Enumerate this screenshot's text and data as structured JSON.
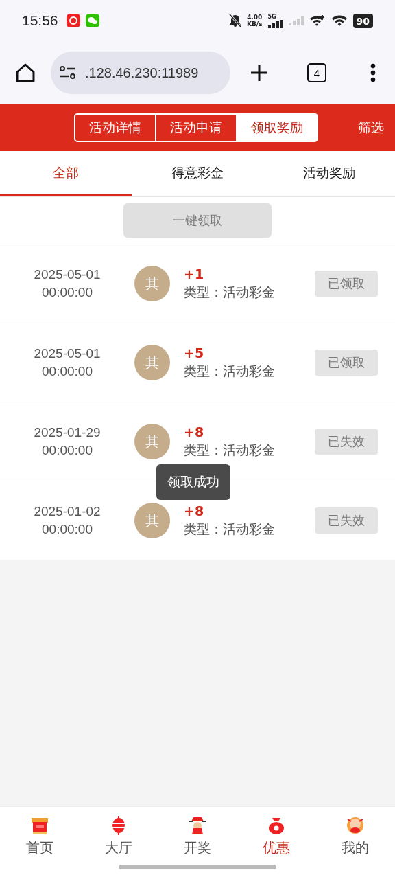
{
  "status_bar": {
    "time": "15:56",
    "speed_value": "4.00",
    "speed_unit": "KB/s",
    "network": "5G",
    "battery": "90"
  },
  "browser": {
    "url": ".128.46.230:11989",
    "tab_count": "4"
  },
  "header": {
    "segments": [
      {
        "label": "活动详情",
        "selected": false
      },
      {
        "label": "活动申请",
        "selected": false
      },
      {
        "label": "领取奖励",
        "selected": true
      }
    ],
    "filter": "筛选"
  },
  "tabs": [
    {
      "label": "全部",
      "selected": true
    },
    {
      "label": "得意彩金",
      "selected": false
    },
    {
      "label": "活动奖励",
      "selected": false
    }
  ],
  "claim_all": {
    "label": "一键领取",
    "disabled": true
  },
  "rows": [
    {
      "date": "2025-05-01",
      "time": "00:00:00",
      "avatar": "其",
      "amount": "+1",
      "type": "类型：活动彩金",
      "status": "已领取"
    },
    {
      "date": "2025-05-01",
      "time": "00:00:00",
      "avatar": "其",
      "amount": "+5",
      "type": "类型：活动彩金",
      "status": "已领取"
    },
    {
      "date": "2025-01-29",
      "time": "00:00:00",
      "avatar": "其",
      "amount": "+8",
      "type": "类型：活动彩金",
      "status": "已失效"
    },
    {
      "date": "2025-01-02",
      "time": "00:00:00",
      "avatar": "其",
      "amount": "+8",
      "type": "类型：活动彩金",
      "status": "已失效"
    }
  ],
  "toast": "领取成功",
  "bottom_nav": [
    {
      "label": "首页",
      "selected": false
    },
    {
      "label": "大厅",
      "selected": false
    },
    {
      "label": "开奖",
      "selected": false
    },
    {
      "label": "优惠",
      "selected": true
    },
    {
      "label": "我的",
      "selected": false
    }
  ]
}
